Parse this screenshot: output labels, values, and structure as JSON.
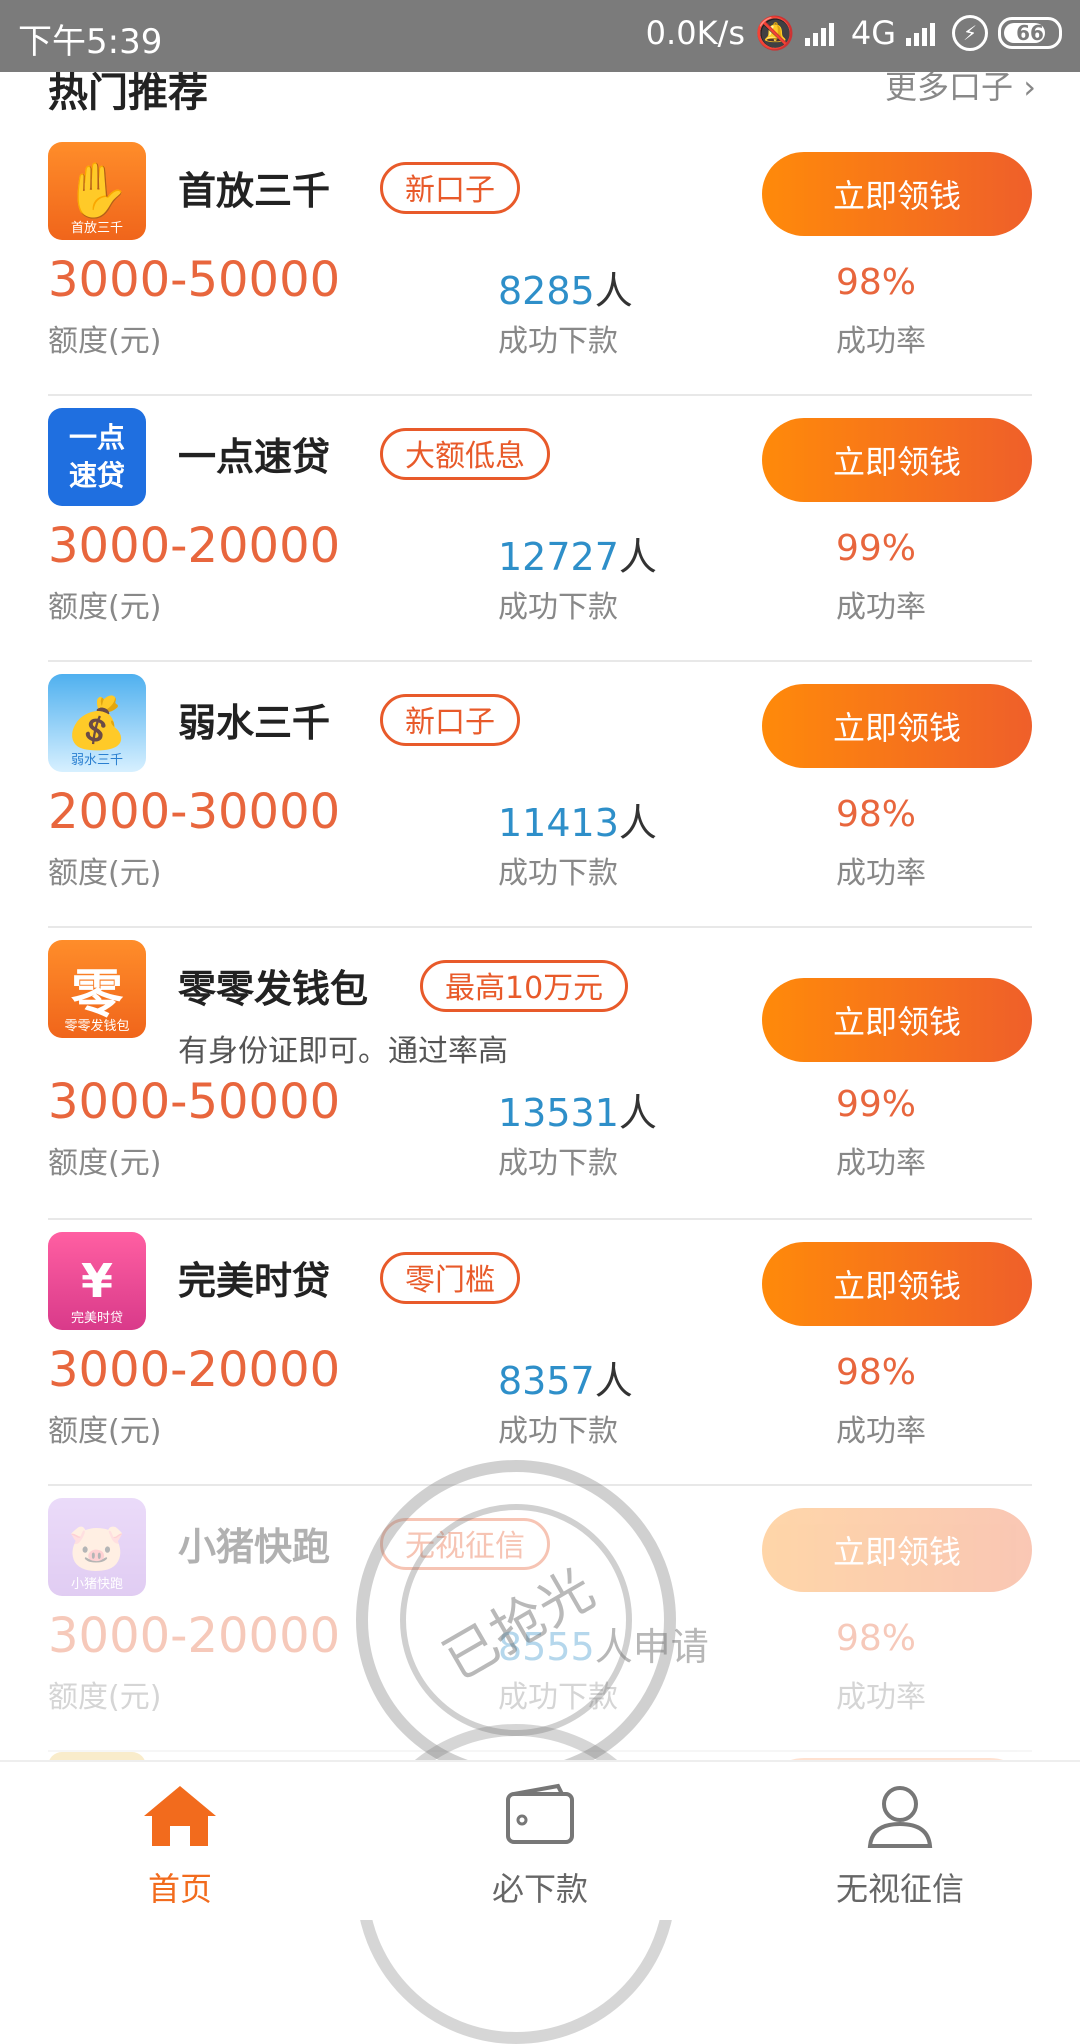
{
  "status_bar": {
    "time": "下午5:39",
    "network_speed": "0.0K/s",
    "network_type": "4G",
    "battery": "66"
  },
  "section": {
    "title": "热门推荐",
    "more_link": "更多口子"
  },
  "products": [
    {
      "name": "首放三千",
      "logo_text": "首放三千",
      "tag": "新口子",
      "cta": "立即领钱",
      "amount": "3000-50000",
      "amount_label": "额度(元)",
      "people_count": "8285",
      "people_unit": "人",
      "people_label": "成功下款",
      "rate": "98%",
      "rate_label": "成功率",
      "logo_color": "#f47a1f"
    },
    {
      "name": "一点速贷",
      "logo_text": "一点速贷",
      "tag": "大额低息",
      "cta": "立即领钱",
      "amount": "3000-20000",
      "amount_label": "额度(元)",
      "people_count": "12727",
      "people_unit": "人",
      "people_label": "成功下款",
      "rate": "99%",
      "rate_label": "成功率",
      "logo_color": "#1f6fe0"
    },
    {
      "name": "弱水三千",
      "logo_text": "弱水三千",
      "tag": "新口子",
      "cta": "立即领钱",
      "amount": "2000-30000",
      "amount_label": "额度(元)",
      "people_count": "11413",
      "people_unit": "人",
      "people_label": "成功下款",
      "rate": "98%",
      "rate_label": "成功率",
      "logo_color": "#58b6ef"
    },
    {
      "name": "零零发钱包",
      "logo_text": "零零发钱包",
      "tag": "最高10万元",
      "subtitle": "有身份证即可。通过率高",
      "cta": "立即领钱",
      "amount": "3000-50000",
      "amount_label": "额度(元)",
      "people_count": "13531",
      "people_unit": "人",
      "people_label": "成功下款",
      "rate": "99%",
      "rate_label": "成功率",
      "logo_color": "#f47a1f"
    },
    {
      "name": "完美时贷",
      "logo_text": "完美时贷",
      "tag": "零门槛",
      "cta": "立即领钱",
      "amount": "3000-20000",
      "amount_label": "额度(元)",
      "people_count": "8357",
      "people_unit": "人",
      "people_label": "成功下款",
      "rate": "98%",
      "rate_label": "成功率",
      "logo_color": "#ea3f8c"
    },
    {
      "name": "小猪快跑",
      "logo_text": "小猪快跑",
      "tag": "无视征信",
      "cta": "立即领钱",
      "amount": "3000-20000",
      "amount_label": "额度(元)",
      "people_count": "8555",
      "people_unit": "人申请",
      "people_label": "成功下款",
      "rate": "98%",
      "rate_label": "成功率",
      "logo_color": "#b07be0",
      "stamp": "已抢光"
    }
  ],
  "bottom_nav": [
    {
      "label": "首页",
      "icon": "home-icon",
      "active": true
    },
    {
      "label": "必下款",
      "icon": "wallet-icon",
      "active": false
    },
    {
      "label": "无视征信",
      "icon": "user-icon",
      "active": false
    }
  ],
  "colors": {
    "accent": "#f26b1d",
    "amount": "#e8663d",
    "count": "#2e8fc9"
  }
}
